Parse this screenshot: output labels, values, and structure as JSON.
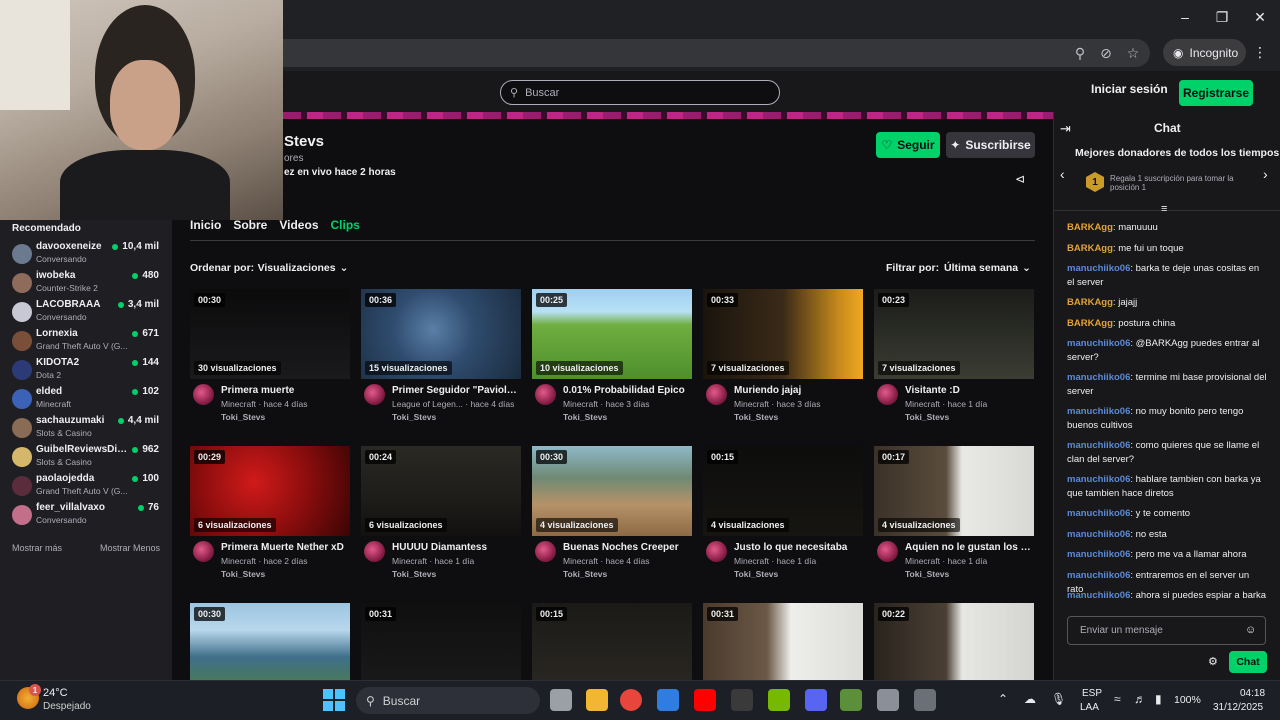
{
  "browser": {
    "incognito_label": "Incognito",
    "icons": [
      "minimize-icon",
      "restore-icon",
      "close-icon",
      "zoom-icon",
      "eye-off-icon",
      "star-icon",
      "incognito-icon",
      "kebab-menu-icon"
    ]
  },
  "header": {
    "search_placeholder": "Buscar",
    "login_label": "Iniciar sesión",
    "register_label": "Registrarse",
    "accent_color": "#00d26a"
  },
  "channel": {
    "name": "Stevs",
    "followers": "ores",
    "live_status": "ez en vivo hace 2 horas",
    "follow_label": "Seguir",
    "subscribe_label": "Suscribirse",
    "tabs": [
      {
        "label": "Inicio",
        "active": false
      },
      {
        "label": "Sobre",
        "active": false
      },
      {
        "label": "Videos",
        "active": false
      },
      {
        "label": "Clips",
        "active": true
      }
    ],
    "order_label": "Ordenar por:",
    "order_value": "Visualizaciones",
    "filter_label": "Filtrar por:",
    "filter_value": "Última semana"
  },
  "sidebar": {
    "title": "Recomendado",
    "items": [
      {
        "name": "davooxeneize",
        "game": "Conversando",
        "viewers": "10,4 mil",
        "color": "#6b7a8f"
      },
      {
        "name": "iwobeka",
        "game": "Counter-Strike 2",
        "viewers": "480",
        "color": "#8f6b5c"
      },
      {
        "name": "LACOBRAAA",
        "game": "Conversando",
        "viewers": "3,4 mil",
        "color": "#c8c8d4"
      },
      {
        "name": "Lornexia",
        "game": "Grand Theft Auto V (G...",
        "viewers": "671",
        "color": "#7a4f3a"
      },
      {
        "name": "KIDOTA2",
        "game": "Dota 2",
        "viewers": "144",
        "color": "#2c3b78"
      },
      {
        "name": "elded",
        "game": "Minecraft",
        "viewers": "102",
        "color": "#3c62b8"
      },
      {
        "name": "sachauzumaki",
        "game": "Slots & Casino",
        "viewers": "4,4 mil",
        "color": "#8a6b55"
      },
      {
        "name": "GuibelReviewsDir...",
        "game": "Slots & Casino",
        "viewers": "962",
        "color": "#d4b76a"
      },
      {
        "name": "paolaojedda",
        "game": "Grand Theft Auto V (G...",
        "viewers": "100",
        "color": "#5a2c3c"
      },
      {
        "name": "feer_villalvaxo",
        "game": "Conversando",
        "viewers": "76",
        "color": "#c46f8a"
      }
    ],
    "show_more": "Mostrar más",
    "show_less": "Mostrar Menos"
  },
  "clips": [
    {
      "duration": "00:30",
      "views": "30 visualizaciones",
      "title": "Primera muerte",
      "meta": "Minecraft · hace 4 días",
      "author": "Toki_Stevs",
      "bg": "linear-gradient(180deg,#0b0b0c,#1a1a1c)"
    },
    {
      "duration": "00:36",
      "views": "15 visualizaciones",
      "title": "Primer Seguidor \"Paviolo...",
      "meta": "League of Legen... · hace 4 días",
      "author": "Toki_Stevs",
      "bg": "radial-gradient(circle at 45% 45%,#5a7fa8 0%,#2f4c6e 40%,#1b2b3e 100%)"
    },
    {
      "duration": "00:25",
      "views": "10 visualizaciones",
      "title": "0.01% Probabilidad Epico",
      "meta": "Minecraft · hace 3 días",
      "author": "Toki_Stevs",
      "bg": "linear-gradient(180deg,#9fd0f0 0%,#b8e0f5 25%,#6fae3f 40%,#4f8f2c 100%)"
    },
    {
      "duration": "00:33",
      "views": "7 visualizaciones",
      "title": "Muriendo jajaj",
      "meta": "Minecraft · hace 3 días",
      "author": "Toki_Stevs",
      "bg": "linear-gradient(90deg,#1a140d 0%,#3a2a18 50%,#c78a1c 85%,#f0a820 100%)"
    },
    {
      "duration": "00:23",
      "views": "7 visualizaciones",
      "title": "Visitante :D",
      "meta": "Minecraft · hace 1 día",
      "author": "Toki_Stevs",
      "bg": "linear-gradient(180deg,#1c1d1a 0%,#2a2c26 50%,#3b3d33 100%)"
    },
    {
      "duration": "00:29",
      "views": "6 visualizaciones",
      "title": "Primera Muerte Nether xD",
      "meta": "Minecraft · hace 2 días",
      "author": "Toki_Stevs",
      "bg": "radial-gradient(circle at 40% 40%,#d11a1a 0%,#8a0d0d 50%,#3a0404 100%)"
    },
    {
      "duration": "00:24",
      "views": "6 visualizaciones",
      "title": "HUUUU Diamantess",
      "meta": "Minecraft · hace 1 día",
      "author": "Toki_Stevs",
      "bg": "linear-gradient(180deg,#2a2924 0%,#1d1c19 60%,#121110 100%)"
    },
    {
      "duration": "00:30",
      "views": "4 visualizaciones",
      "title": "Buenas Noches Creeper",
      "meta": "Minecraft · hace 4 días",
      "author": "Toki_Stevs",
      "bg": "linear-gradient(180deg,#8fb9c8 0%,#6f8a74 35%,#b59268 65%,#8e6a44 100%)"
    },
    {
      "duration": "00:15",
      "views": "4 visualizaciones",
      "title": "Justo lo que necesitaba",
      "meta": "Minecraft · hace 1 día",
      "author": "Toki_Stevs",
      "bg": "linear-gradient(180deg,#0d0d0c 0%,#161512 100%)"
    },
    {
      "duration": "00:17",
      "views": "4 visualizaciones",
      "title": "Aquien no le gustan los Di...",
      "meta": "Minecraft · hace 1 día",
      "author": "Toki_Stevs",
      "bg": "linear-gradient(90deg,#3a3128 0%,#5a4c3d 45%,#e9e9e6 55%,#d8d8d4 100%)"
    },
    {
      "duration": "00:30",
      "views": "",
      "title": "",
      "meta": "",
      "author": "",
      "bg": "linear-gradient(180deg,#9cc4e0 0%,#b8d8ec 30%,#3f6f8a 60%,#4e7d46 100%)"
    },
    {
      "duration": "00:31",
      "views": "",
      "title": "",
      "meta": "",
      "author": "",
      "bg": "linear-gradient(180deg,#0f0f0f 0%,#1a1a1a 100%)"
    },
    {
      "duration": "00:15",
      "views": "",
      "title": "",
      "meta": "",
      "author": "",
      "bg": "linear-gradient(180deg,#1b1a17 0%,#2b2823 100%)"
    },
    {
      "duration": "00:31",
      "views": "",
      "title": "",
      "meta": "",
      "author": "",
      "bg": "linear-gradient(90deg,#4a3b2e 0%,#6b5846 40%,#eeeeea 55%,#dcdcd8 100%)"
    },
    {
      "duration": "00:22",
      "views": "",
      "title": "",
      "meta": "",
      "author": "",
      "bg": "linear-gradient(90deg,#2a241e 0%,#4a3f34 45%,#e6e6e2 55%,#d4d4d0 100%)"
    }
  ],
  "chat": {
    "title": "Chat",
    "top_donors_title": "Mejores donadores de todos los tiempos",
    "donor_rank": "1",
    "donor_text": "Regala 1 suscripción para tomar la posición 1",
    "messages": [
      {
        "user": "BARKAgg",
        "kind": "bark",
        "text": "manuuuu",
        "lines": 1
      },
      {
        "user": "BARKAgg",
        "kind": "bark",
        "text": "me fui un toque",
        "lines": 1
      },
      {
        "user": "manuchiiko06",
        "kind": "manu",
        "text": "barka te deje unas cositas en el server",
        "lines": 2
      },
      {
        "user": "BARKAgg",
        "kind": "bark",
        "text": "jajajj",
        "lines": 1
      },
      {
        "user": "BARKAgg",
        "kind": "bark",
        "text": "postura china",
        "lines": 1
      },
      {
        "user": "manuchiiko06",
        "kind": "manu",
        "text": "@BARKAgg puedes entrar al server?",
        "lines": 2
      },
      {
        "user": "manuchiiko06",
        "kind": "manu",
        "text": "termine mi base provisional del server",
        "lines": 2
      },
      {
        "user": "manuchiiko06",
        "kind": "manu",
        "text": "no muy bonito pero tengo buenos cultivos",
        "lines": 2
      },
      {
        "user": "manuchiiko06",
        "kind": "manu",
        "text": "como quieres que se llame el clan del server?",
        "lines": 2
      },
      {
        "user": "manuchiiko06",
        "kind": "manu",
        "text": "hablare tambien con barka ya que tambien hace diretos",
        "lines": 2
      },
      {
        "user": "manuchiiko06",
        "kind": "manu",
        "text": "y te comento",
        "lines": 1
      },
      {
        "user": "manuchiiko06",
        "kind": "manu",
        "text": "no esta",
        "lines": 1
      },
      {
        "user": "manuchiiko06",
        "kind": "manu",
        "text": "pero me va a llamar ahora",
        "lines": 1
      },
      {
        "user": "manuchiiko06",
        "kind": "manu",
        "text": "entraremos en el server un rato",
        "lines": 1
      },
      {
        "user": "manuchiiko06",
        "kind": "manu",
        "text": "ahora si puedes espiar a barka",
        "lines": 1
      }
    ],
    "input_placeholder": "Enviar un mensaje",
    "send_label": "Chat"
  },
  "taskbar": {
    "weather_badge": "1",
    "temperature": "24°C",
    "condition": "Despejado",
    "search_label": "Buscar",
    "lang_line1": "ESP",
    "lang_line2": "LAA",
    "battery": "100%",
    "time": "04:18",
    "date": "31/12/2025",
    "apps": [
      {
        "name": "task-view-icon",
        "color": "#9aa0a6"
      },
      {
        "name": "file-explorer-icon",
        "color": "#f2b632"
      },
      {
        "name": "chrome-icon",
        "color": "#e8453c"
      },
      {
        "name": "affinity-icon",
        "color": "#2f7de1"
      },
      {
        "name": "youtube-icon",
        "color": "#ff0000"
      },
      {
        "name": "obs-icon",
        "color": "#3a3a3a"
      },
      {
        "name": "nvidia-icon",
        "color": "#76b900"
      },
      {
        "name": "discord-icon",
        "color": "#5865f2"
      },
      {
        "name": "minecraft-icon",
        "color": "#5b8f3a"
      },
      {
        "name": "settings-icon",
        "color": "#8a8f98"
      },
      {
        "name": "media-player-icon",
        "color": "#6b6f78"
      }
    ]
  }
}
